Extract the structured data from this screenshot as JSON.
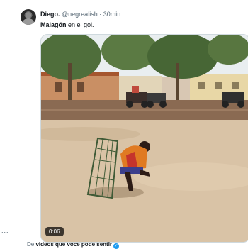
{
  "tweet": {
    "author_name": "Diego.",
    "handle": "@negrealish",
    "separator": "·",
    "time": "30min",
    "text_bold": "Malagón",
    "text_rest": " en el gol."
  },
  "video": {
    "timestamp": "0:06"
  },
  "caption": {
    "prefix": "De ",
    "source": "videos que voce pode sentir"
  },
  "side": {
    "more": "..."
  },
  "colors": {
    "text": "#0f1419",
    "secondary": "#536471",
    "verified": "#1d9bf0"
  }
}
